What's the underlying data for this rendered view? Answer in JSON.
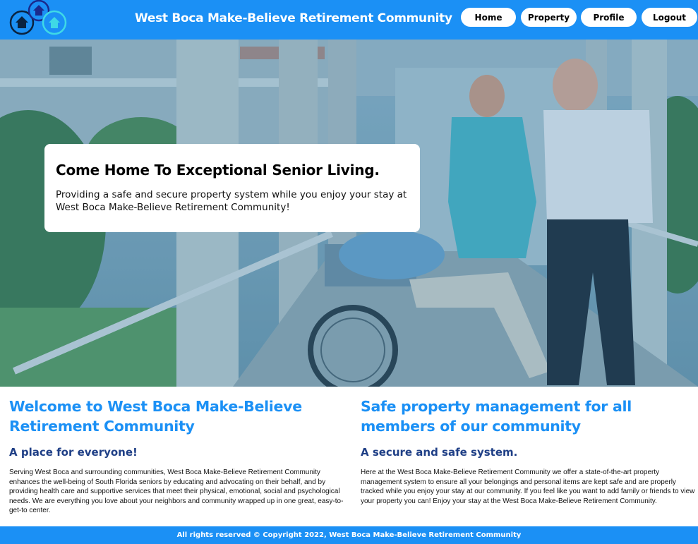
{
  "header": {
    "title": "West Boca Make-Believe Retirement Community",
    "logo_icon": "houses-logo-icon"
  },
  "nav": {
    "home": "Home",
    "property": "Property",
    "profile": "Profile",
    "logout": "Logout"
  },
  "hero": {
    "heading": "Come Home To Exceptional Senior Living.",
    "text": "Providing a safe and secure property system while you enjoy your stay at West Boca Make-Believe Retirement Community!"
  },
  "sections": [
    {
      "title": "Welcome to West Boca Make-Believe Retirement Community",
      "subtitle": "A place for everyone!",
      "body": "Serving West Boca and surrounding communities, West Boca Make-Believe Retirement Community enhances the well-being of South Florida seniors by educating and advocating on their behalf, and by providing health care and supportive services that meet their physical, emotional, social and psychological needs. We are everything you love about your neighbors and community wrapped up in one great, easy-to-get-to center."
    },
    {
      "title": "Safe property management for all members of our community",
      "subtitle": "A secure and safe system.",
      "body": "Here at the West Boca Make-Believe Retirement Community we offer a state-of-the-art property management system to ensure all your belongings and personal items are kept safe and are properly tracked while you enjoy your stay at our community. If you feel like you want to add family or friends to view your property you can! Enjoy your stay at the West Boca Make-Believe Retirement Community."
    }
  ],
  "footer": {
    "text": "All rights reserved © Copyright 2022, West Boca Make-Believe Retirement Community"
  },
  "colors": {
    "brand_blue": "#1b90f5",
    "subheading_navy": "#1f3f86",
    "hero_tint": "#3b6f8a"
  }
}
